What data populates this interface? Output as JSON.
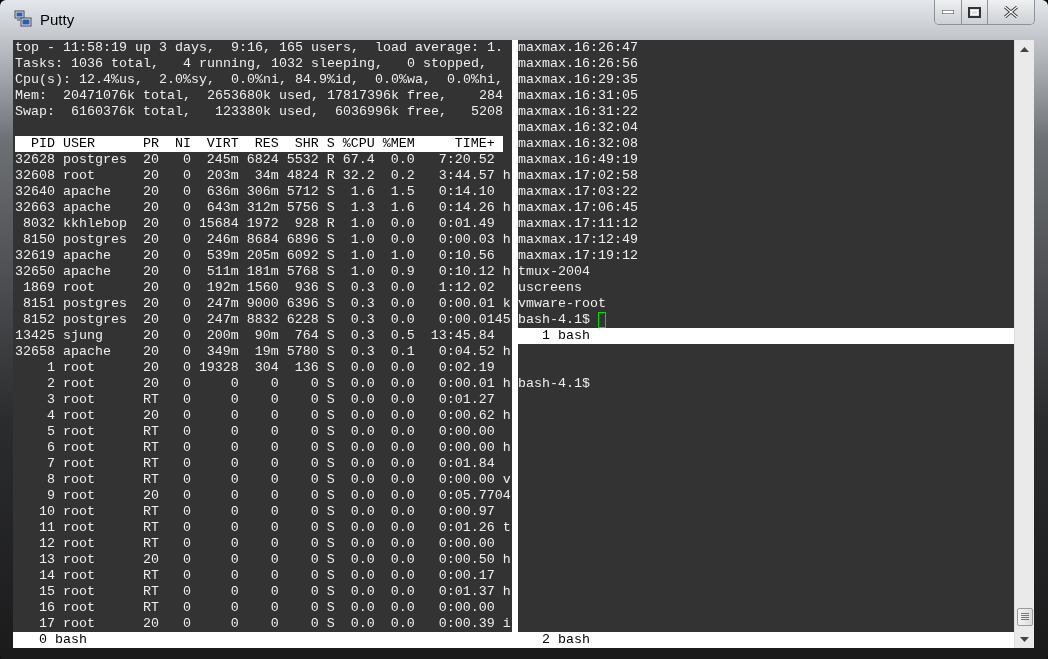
{
  "window": {
    "title": "Putty"
  },
  "left_pane": {
    "summary": [
      "top - 11:58:19 up 3 days,  9:16, 165 users,  load average: 1.",
      "Tasks: 1036 total,   4 running, 1032 sleeping,   0 stopped,",
      "Cpu(s): 12.4%us,  2.0%sy,  0.0%ni, 84.9%id,  0.0%wa,  0.0%hi,",
      "Mem:  20471076k total,  2653680k used, 17817396k free,    284",
      "Swap:  6160376k total,   123380k used,  6036996k free,   5208"
    ],
    "table": {
      "columns": [
        "PID",
        "USER",
        "PR",
        "NI",
        "VIRT",
        "RES",
        "SHR",
        "S",
        "%CPU",
        "%MEM",
        "TIME+"
      ],
      "rows": [
        {
          "cells": [
            "32628",
            "postgres",
            "20",
            "0",
            "245m",
            "6824",
            "5532",
            "R",
            "67.4",
            "0.0",
            "7:20.52"
          ]
        },
        {
          "cells": [
            "32608",
            "root",
            "20",
            "0",
            "203m",
            "34m",
            "4824",
            "R",
            "32.2",
            "0.2",
            "3:44.57"
          ],
          "column_12": "h"
        },
        {
          "cells": [
            "32640",
            "apache",
            "20",
            "0",
            "636m",
            "306m",
            "5712",
            "S",
            "1.6",
            "1.5",
            "0:14.10"
          ]
        },
        {
          "cells": [
            "32663",
            "apache",
            "20",
            "0",
            "643m",
            "312m",
            "5756",
            "S",
            "1.3",
            "1.6",
            "0:14.26"
          ],
          "column_12": "h"
        },
        {
          "cells": [
            "8032",
            "kkhlebop",
            "20",
            "0",
            "15684",
            "1972",
            "928",
            "R",
            "1.0",
            "0.0",
            "0:01.49"
          ]
        },
        {
          "cells": [
            "8150",
            "postgres",
            "20",
            "0",
            "246m",
            "8684",
            "6896",
            "S",
            "1.0",
            "0.0",
            "0:00.03"
          ],
          "column_12": "h"
        },
        {
          "cells": [
            "32619",
            "apache",
            "20",
            "0",
            "539m",
            "205m",
            "6092",
            "S",
            "1.0",
            "1.0",
            "0:10.56"
          ]
        },
        {
          "cells": [
            "32650",
            "apache",
            "20",
            "0",
            "511m",
            "181m",
            "5768",
            "S",
            "1.0",
            "0.9",
            "0:10.12"
          ],
          "column_12": "h"
        },
        {
          "cells": [
            "1869",
            "root",
            "20",
            "0",
            "192m",
            "1560",
            "936",
            "S",
            "0.3",
            "0.0",
            "1:12.02"
          ]
        },
        {
          "cells": [
            "8151",
            "postgres",
            "20",
            "0",
            "247m",
            "9000",
            "6396",
            "S",
            "0.3",
            "0.0",
            "0:00.01"
          ],
          "column_12": "k"
        },
        {
          "cells": [
            "8152",
            "postgres",
            "20",
            "0",
            "247m",
            "8832",
            "6228",
            "S",
            "0.3",
            "0.0",
            "0:00.01"
          ],
          "column_12": "45"
        },
        {
          "cells": [
            "13425",
            "sjung",
            "20",
            "0",
            "200m",
            "90m",
            "764",
            "S",
            "0.3",
            "0.5",
            "13:45.84"
          ]
        },
        {
          "cells": [
            "32658",
            "apache",
            "20",
            "0",
            "349m",
            "19m",
            "5780",
            "S",
            "0.3",
            "0.1",
            "0:04.52"
          ],
          "column_12": "h"
        },
        {
          "cells": [
            "1",
            "root",
            "20",
            "0",
            "19328",
            "304",
            "136",
            "S",
            "0.0",
            "0.0",
            "0:02.19"
          ]
        },
        {
          "cells": [
            "2",
            "root",
            "20",
            "0",
            "0",
            "0",
            "0",
            "S",
            "0.0",
            "0.0",
            "0:00.01"
          ],
          "column_12": "h"
        },
        {
          "cells": [
            "3",
            "root",
            "RT",
            "0",
            "0",
            "0",
            "0",
            "S",
            "0.0",
            "0.0",
            "0:01.27"
          ]
        },
        {
          "cells": [
            "4",
            "root",
            "20",
            "0",
            "0",
            "0",
            "0",
            "S",
            "0.0",
            "0.0",
            "0:00.62"
          ],
          "column_12": "h"
        },
        {
          "cells": [
            "5",
            "root",
            "RT",
            "0",
            "0",
            "0",
            "0",
            "S",
            "0.0",
            "0.0",
            "0:00.00"
          ]
        },
        {
          "cells": [
            "6",
            "root",
            "RT",
            "0",
            "0",
            "0",
            "0",
            "S",
            "0.0",
            "0.0",
            "0:00.00"
          ],
          "column_12": "h"
        },
        {
          "cells": [
            "7",
            "root",
            "RT",
            "0",
            "0",
            "0",
            "0",
            "S",
            "0.0",
            "0.0",
            "0:01.84"
          ]
        },
        {
          "cells": [
            "8",
            "root",
            "RT",
            "0",
            "0",
            "0",
            "0",
            "S",
            "0.0",
            "0.0",
            "0:00.00"
          ],
          "column_12": "v"
        },
        {
          "cells": [
            "9",
            "root",
            "20",
            "0",
            "0",
            "0",
            "0",
            "S",
            "0.0",
            "0.0",
            "0:05.77"
          ],
          "column_12": "04"
        },
        {
          "cells": [
            "10",
            "root",
            "RT",
            "0",
            "0",
            "0",
            "0",
            "S",
            "0.0",
            "0.0",
            "0:00.97"
          ]
        },
        {
          "cells": [
            "11",
            "root",
            "RT",
            "0",
            "0",
            "0",
            "0",
            "S",
            "0.0",
            "0.0",
            "0:01.26"
          ],
          "column_12": "t"
        },
        {
          "cells": [
            "12",
            "root",
            "RT",
            "0",
            "0",
            "0",
            "0",
            "S",
            "0.0",
            "0.0",
            "0:00.00"
          ]
        },
        {
          "cells": [
            "13",
            "root",
            "20",
            "0",
            "0",
            "0",
            "0",
            "S",
            "0.0",
            "0.0",
            "0:00.50"
          ],
          "column_12": "h"
        },
        {
          "cells": [
            "14",
            "root",
            "RT",
            "0",
            "0",
            "0",
            "0",
            "S",
            "0.0",
            "0.0",
            "0:00.17"
          ]
        },
        {
          "cells": [
            "15",
            "root",
            "RT",
            "0",
            "0",
            "0",
            "0",
            "S",
            "0.0",
            "0.0",
            "0:01.37"
          ],
          "column_12": "h"
        },
        {
          "cells": [
            "16",
            "root",
            "RT",
            "0",
            "0",
            "0",
            "0",
            "S",
            "0.0",
            "0.0",
            "0:00.00"
          ]
        },
        {
          "cells": [
            "17",
            "root",
            "20",
            "0",
            "0",
            "0",
            "0",
            "S",
            "0.0",
            "0.0",
            "0:00.39"
          ],
          "column_12": "i"
        }
      ]
    }
  },
  "right_top_pane": {
    "lines": [
      "maxmax.16:26:47",
      "maxmax.16:26:56",
      "maxmax.16:29:35",
      "maxmax.16:31:05",
      "maxmax.16:31:22",
      "maxmax.16:32:04",
      "maxmax.16:32:08",
      "maxmax.16:49:19",
      "maxmax.17:02:58",
      "maxmax.17:03:22",
      "maxmax.17:06:45",
      "maxmax.17:11:12",
      "maxmax.17:12:49",
      "maxmax.17:19:12",
      "tmux-2004",
      "uscreens",
      "vmware-root"
    ],
    "prompt": "bash-4.1$",
    "cursor": true,
    "status": "1 bash"
  },
  "right_bottom_pane": {
    "prompt": "bash-4.1$"
  },
  "status_bar": {
    "left": "0 bash",
    "right": "2 bash"
  }
}
